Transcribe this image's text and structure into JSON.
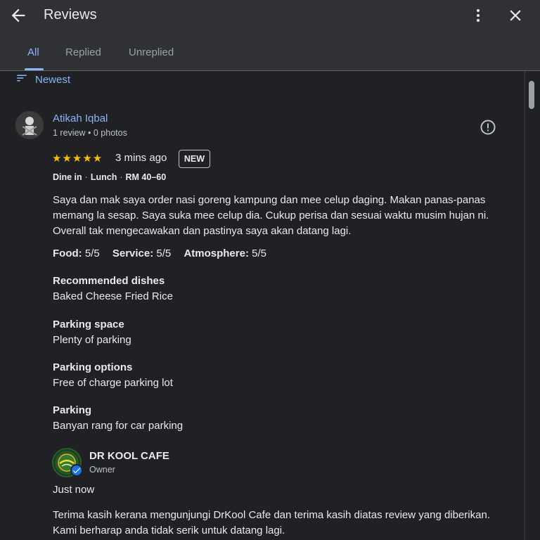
{
  "header": {
    "title": "Reviews",
    "back_icon": "arrow-back-icon",
    "more_icon": "more-vert-icon",
    "close_icon": "close-icon"
  },
  "tabs": [
    {
      "label": "All",
      "active": true
    },
    {
      "label": "Replied",
      "active": false
    },
    {
      "label": "Unreplied",
      "active": false
    }
  ],
  "sort": {
    "label": "Newest",
    "icon": "sort-icon"
  },
  "review": {
    "reviewer_name": "Atikah Iqbal",
    "reviewer_meta": "1 review • 0 photos",
    "rating": 5,
    "stars": "★★★★★",
    "time": "3 mins ago",
    "badge": "NEW",
    "visit": {
      "type": "Dine in",
      "meal": "Lunch",
      "price": "RM 40–60"
    },
    "text": "Saya dan mak saya order nasi goreng kampung dan mee celup daging. Makan panas-panas memang la sesap. Saya suka mee celup dia. Cukup perisa dan sesuai waktu musim hujan ni. Overall tak mengecawakan dan pastinya saya akan datang lagi.",
    "ratings": [
      {
        "label": "Food:",
        "value": "5/5"
      },
      {
        "label": "Service:",
        "value": "5/5"
      },
      {
        "label": "Atmosphere:",
        "value": "5/5"
      }
    ],
    "attributes": [
      {
        "title": "Recommended dishes",
        "value": "Baked Cheese Fried Rice"
      },
      {
        "title": "Parking space",
        "value": "Plenty of parking"
      },
      {
        "title": "Parking options",
        "value": "Free of charge parking lot"
      },
      {
        "title": "Parking",
        "value": "Banyan rang for car parking"
      }
    ]
  },
  "reply": {
    "owner_name": "DR KOOL CAFE",
    "owner_role": "Owner",
    "time": "Just now",
    "text": "Terima kasih kerana mengunjungi DrKool Cafe dan terima kasih diatas review yang diberikan. Kami berharap anda tidak serik untuk datang lagi."
  },
  "colors": {
    "accent": "#8ab4f8",
    "star": "#fbbc04",
    "background": "#202124",
    "header": "#303134"
  }
}
